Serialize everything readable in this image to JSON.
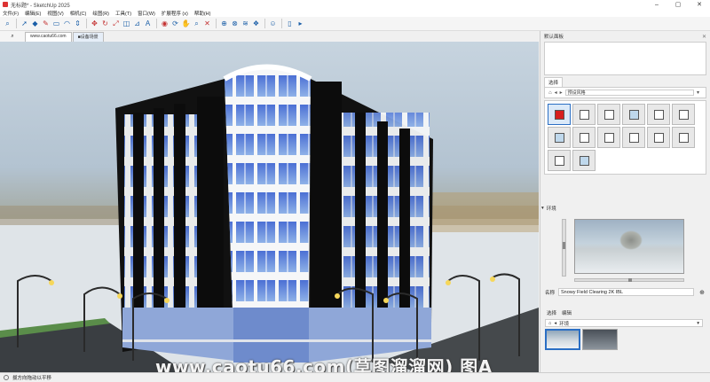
{
  "window": {
    "title": "无标题* - SketchUp 2025"
  },
  "menu": [
    "文件(F)",
    "编辑(E)",
    "视图(V)",
    "相机(C)",
    "绘图(R)",
    "工具(T)",
    "窗口(W)",
    "扩展程序 (x)",
    "帮助(H)"
  ],
  "scene_tabs": [
    "www.caotu66.com",
    "■设备场景"
  ],
  "status": {
    "hint": "拔方向拖动以平移"
  },
  "watermark": "www.caotu66.com(草图溜溜网) 图A",
  "tray": {
    "default_panel": "默认面板",
    "select_tab": "选择",
    "edit_tab": "编辑",
    "style_dropdown": "预设风格",
    "env_header": "环境",
    "env_name_label": "名称",
    "env_name_value": "Snowy Field Clearing 2K IBL",
    "env_dropdown": "环境"
  },
  "colors": {
    "accent": "#2b6fc4",
    "selected_style": "#d71f1f"
  }
}
